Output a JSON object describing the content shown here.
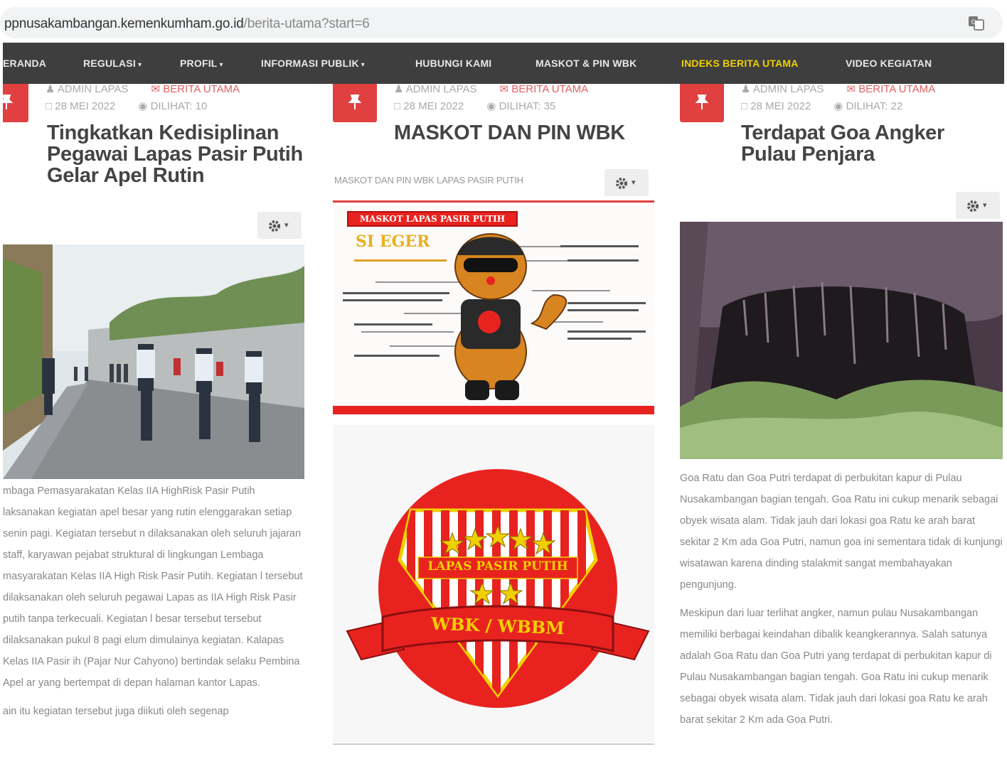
{
  "browser": {
    "url_host": "ppnusakambangan.kemenkumham.go.id",
    "url_path": "/berita-utama?start=6"
  },
  "navbar": {
    "items": [
      {
        "label": "ERANDA",
        "dropdown": false
      },
      {
        "label": "REGULASI",
        "dropdown": true
      },
      {
        "label": "PROFIL",
        "dropdown": true
      },
      {
        "label": "INFORMASI PUBLIK",
        "dropdown": true
      },
      {
        "label": "HUBUNGI KAMI",
        "dropdown": false
      },
      {
        "label": "MASKOT & PIN WBK",
        "dropdown": false
      },
      {
        "label": "INDEKS BERITA UTAMA",
        "dropdown": false,
        "active": true
      },
      {
        "label": "VIDEO KEGIATAN",
        "dropdown": false
      }
    ],
    "caret": "▾",
    "background": "#3e3e3e",
    "active_color": "#f0d000"
  },
  "articles": [
    {
      "author": "ADMIN LAPAS",
      "category": "BERITA UTAMA",
      "date": "28 MEI 2022",
      "views": "DILIHAT: 10",
      "title": "Tingkatkan Kedisiplinan Pegawai Lapas Pasir Putih Gelar Apel Rutin",
      "paragraphs": [
        "mbaga Pemasyarakatan Kelas IIA HighRisk Pasir Putih laksanakan kegiatan apel besar yang rutin elenggarakan setiap senin pagi. Kegiatan tersebut n dilaksanakan oleh seluruh jajaran staff, karyawan pejabat struktural di lingkungan Lembaga masyarakatan Kelas IIA High Risk Pasir Putih. Kegiatan l tersebut dilaksanakan oleh seluruh pegawai Lapas as IIA High Risk Pasir putih tanpa terkecuali. Kegiatan l besar tersebut tersebut dilaksanakan pukul 8 pagi elum dimulainya kegiatan. Kalapas Kelas IIA Pasir ih (Pajar Nur Cahyono) bertindak selaku Pembina Apel ar yang bertempat di depan halaman kantor Lapas.",
        "ain itu kegiatan tersebut juga diikuti oleh segenap"
      ]
    },
    {
      "author": "ADMIN LAPAS",
      "category": "BERITA UTAMA",
      "date": "28 MEI 2022",
      "views": "DILIHAT: 35",
      "title": "MASKOT DAN PIN WBK",
      "subtitle": "MASKOT DAN PIN WBK LAPAS PASIR PUTIH",
      "mascot": {
        "banner": "MASKOT LAPAS PASIR PUTIH",
        "name": "SI EGER"
      },
      "pin": {
        "top": "LAPAS PASIR PUTIH",
        "ribbon": "WBK / WBBM"
      }
    },
    {
      "author": "ADMIN LAPAS",
      "category": "BERITA UTAMA",
      "date": "28 MEI 2022",
      "views": "DILIHAT: 22",
      "title": "Terdapat Goa Angker Pulau Penjara",
      "paragraphs": [
        "Goa Ratu dan Goa Putri terdapat di perbukitan kapur di Pulau Nusakambangan bagian tengah. Goa Ratu ini cukup menarik sebagai obyek wisata alam. Tidak jauh dari lokasi goa Ratu ke arah barat sekitar 2 Km ada Goa Putri, namun goa ini sementara tidak di kunjungi wisatawan karena dinding stalakmit sangat membahayakan pengunjung.",
        "Meskipun dari luar terlihat angker, namun pulau Nusakambangan memiliki berbagai keindahan dibalik keangkerannya. Salah satunya adalah Goa Ratu dan Goa Putri yang terdapat di perbukitan kapur di Pulau Nusakambangan bagian tengah. Goa Ratu ini cukup menarik sebagai obyek wisata alam. Tidak jauh dari lokasi goa Ratu ke arah barat sekitar 2 Km ada Goa Putri."
      ]
    }
  ],
  "colors": {
    "accent_red": "#e04040",
    "pin_red": "#e8231f",
    "title_text": "#444444"
  }
}
